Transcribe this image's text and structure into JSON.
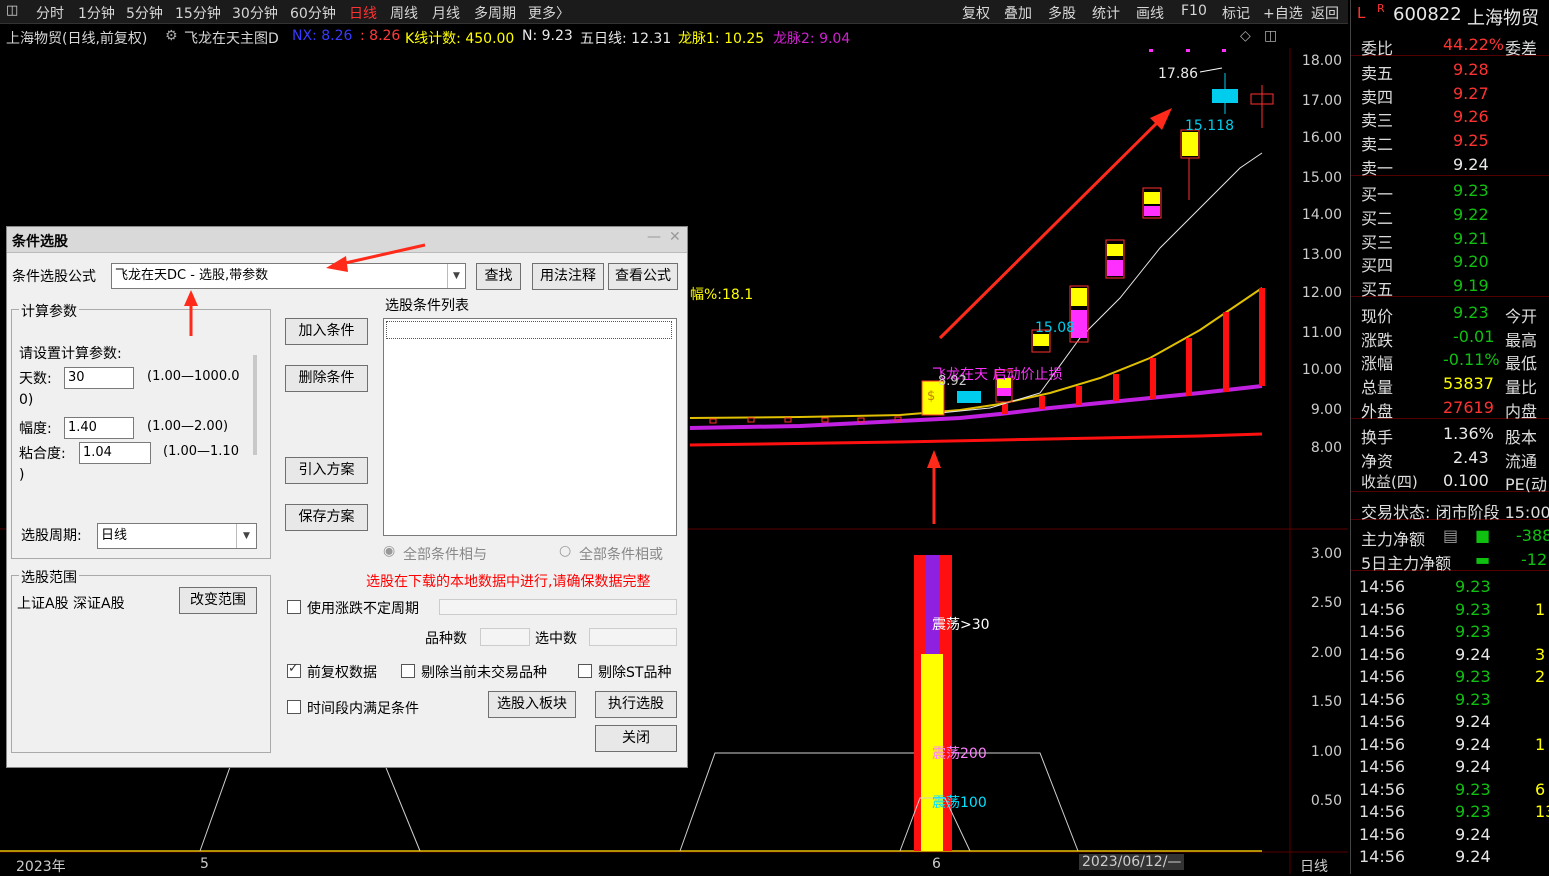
{
  "topbar": {
    "toggle_icon": "panel-icon",
    "periods": [
      "分时",
      "1分钟",
      "5分钟",
      "15分钟",
      "30分钟",
      "60分钟",
      "日线",
      "周线",
      "月线",
      "多周期",
      "更多〉"
    ],
    "active_period": "日线",
    "tools": [
      "复权",
      "叠加",
      "多股",
      "统计",
      "画线",
      "F10",
      "标记",
      "+自选",
      "返回"
    ]
  },
  "info": {
    "stock": "上海物贸(日线,前复权)",
    "formula": "飞龙在天主图D",
    "nx_label": "NX: 8.26",
    "v2": ": 8.26",
    "kcount": "K线计数: 450.00",
    "n": "N: 9.23",
    "ma5": "五日线: 12.31",
    "long1": "龙脉1: 10.25",
    "long2": "龙脉2: 9.04"
  },
  "chart_labels": {
    "peak": "17.86",
    "p15": "15.118",
    "p1508": "15.08",
    "amp": "幅%:18.1",
    "signal": "飞龙在天 启动价止损",
    "low_label": "8.92",
    "z30": "震荡>30",
    "z200": "震荡200",
    "z100": "震荡100"
  },
  "price_axis": [
    "18.00",
    "17.00",
    "16.00",
    "15.00",
    "14.00",
    "13.00",
    "12.00",
    "11.00",
    "10.00",
    "9.00",
    "8.00"
  ],
  "ind_axis": [
    "3.00",
    "2.50",
    "2.00",
    "1.50",
    "1.00",
    "0.50"
  ],
  "date_axis": {
    "year": "2023年",
    "m5": "5",
    "m6": "6",
    "cursor": "2023/06/12/—",
    "period": "日线"
  },
  "right_panel": {
    "code": "600822",
    "name": "上海物贸",
    "wb_label": "委比",
    "wb_value": "44.22%",
    "wc_label": "委差",
    "asks": [
      [
        "卖五",
        "9.28"
      ],
      [
        "卖四",
        "9.27"
      ],
      [
        "卖三",
        "9.26"
      ],
      [
        "卖二",
        "9.25"
      ],
      [
        "卖一",
        "9.24"
      ]
    ],
    "bids": [
      [
        "买一",
        "9.23"
      ],
      [
        "买二",
        "9.22"
      ],
      [
        "买三",
        "9.21"
      ],
      [
        "买四",
        "9.20"
      ],
      [
        "买五",
        "9.19"
      ]
    ],
    "quote": [
      [
        "现价",
        "9.23",
        "今开"
      ],
      [
        "涨跌",
        "-0.01",
        "最高"
      ],
      [
        "涨幅",
        "-0.11%",
        "最低"
      ],
      [
        "总量",
        "53837",
        "量比"
      ],
      [
        "外盘",
        "27619",
        "内盘"
      ],
      [
        "换手",
        "1.36%",
        "股本"
      ],
      [
        "净资",
        "2.43",
        "流通"
      ],
      [
        "收益(四)",
        "0.100",
        "PE(动"
      ]
    ],
    "status": "交易状态: 闭市阶段 15:00",
    "main_flow": "主力净额",
    "main_flow_val": "-388",
    "main_flow5": "5日主力净额",
    "main_flow5_val": "-12",
    "ticks": [
      [
        "14:56",
        "9.23",
        ""
      ],
      [
        "14:56",
        "9.23",
        "1"
      ],
      [
        "14:56",
        "9.23",
        ""
      ],
      [
        "14:56",
        "9.24",
        "3"
      ],
      [
        "14:56",
        "9.23",
        "2"
      ],
      [
        "14:56",
        "9.23",
        ""
      ],
      [
        "14:56",
        "9.24",
        ""
      ],
      [
        "14:56",
        "9.24",
        "1"
      ],
      [
        "14:56",
        "9.24",
        ""
      ],
      [
        "14:56",
        "9.23",
        "6"
      ],
      [
        "14:56",
        "9.23",
        "13"
      ],
      [
        "14:56",
        "9.24",
        ""
      ],
      [
        "14:56",
        "9.24",
        ""
      ]
    ]
  },
  "dialog": {
    "title": "条件选股",
    "formula_label": "条件选股公式",
    "formula_value": "飞龙在天DC  -  选股,带参数",
    "find_btn": "查找",
    "usage_btn": "用法注释",
    "view_btn": "查看公式",
    "params_group": "计算参数",
    "params_prompt": "请设置计算参数:",
    "p1_label": "天数:",
    "p1_value": "30",
    "p1_range": "(1.00—1000.0",
    "p1_range2": "0)",
    "p2_label": "幅度:",
    "p2_value": "1.40",
    "p2_range": "(1.00—2.00)",
    "p3_label": "粘合度:",
    "p3_value": "1.04",
    "p3_range": "(1.00—1.10",
    "p3_range2": ")",
    "period_label": "选股周期:",
    "period_value": "日线",
    "scope_group": "选股范围",
    "scope_value": "上证A股 深证A股",
    "change_scope": "改变范围",
    "list_label": "选股条件列表",
    "add_cond": "加入条件",
    "del_cond": "删除条件",
    "import_plan": "引入方案",
    "save_plan": "保存方案",
    "all_and": "全部条件相与",
    "all_or": "全部条件相或",
    "warning": "选股在下载的本地数据中进行,请确保数据完整",
    "use_var_period": "使用涨跌不定周期",
    "count_label": "品种数",
    "selected_label": "选中数",
    "adj": "前复权数据",
    "excl_untraded": "剔除当前未交易品种",
    "excl_st": "剔除ST品种",
    "time_range": "时间段内满足条件",
    "to_block": "选股入板块",
    "execute": "执行选股",
    "close": "关闭"
  }
}
